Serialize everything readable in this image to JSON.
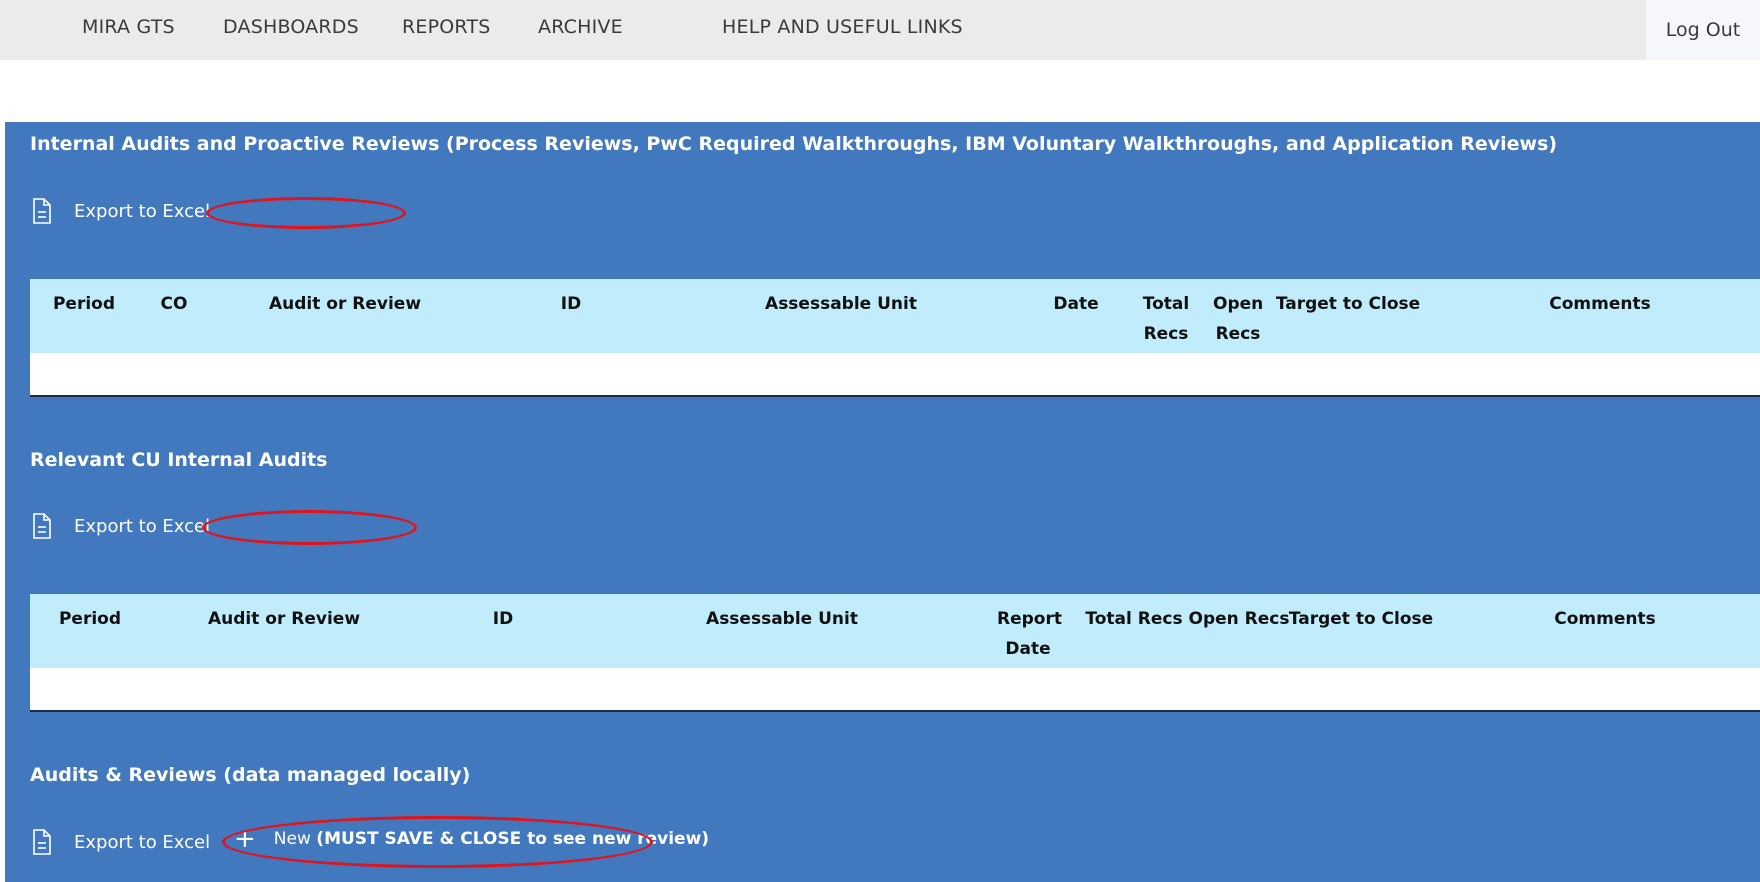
{
  "nav": {
    "items": [
      "MIRA GTS",
      "DASHBOARDS",
      "REPORTS",
      "ARCHIVE",
      "HELP AND USEFUL LINKS"
    ],
    "logout": "Log Out"
  },
  "section1": {
    "title": "Internal Audits and Proactive Reviews (Process Reviews, PwC Required Walkthroughs, IBM Voluntary Walkthroughs, and Application Reviews)",
    "export_label": "Export to Excel",
    "columns": [
      "Period",
      "CO",
      "Audit or Review",
      "ID",
      "Assessable Unit",
      "Date",
      "Total Recs",
      "Open Recs",
      "Target to Close",
      "Comments"
    ]
  },
  "section2": {
    "title": "Relevant CU Internal Audits",
    "export_label": "Export to Excel",
    "columns": [
      "Period",
      "Audit or Review",
      "ID",
      "Assessable Unit",
      "Report Date",
      "Total Recs",
      "Open Recs",
      "Target to Close",
      "Comments"
    ]
  },
  "section3": {
    "title": "Audits & Reviews (data managed locally)",
    "export_label": "Export to Excel",
    "new_label": "New",
    "new_note": "(MUST SAVE & CLOSE to see new review)"
  },
  "colors": {
    "nav_bg": "#ebebeb",
    "main_bg": "#4278be",
    "header_bg": "#c0ecfb",
    "highlight": "#e0141e"
  }
}
